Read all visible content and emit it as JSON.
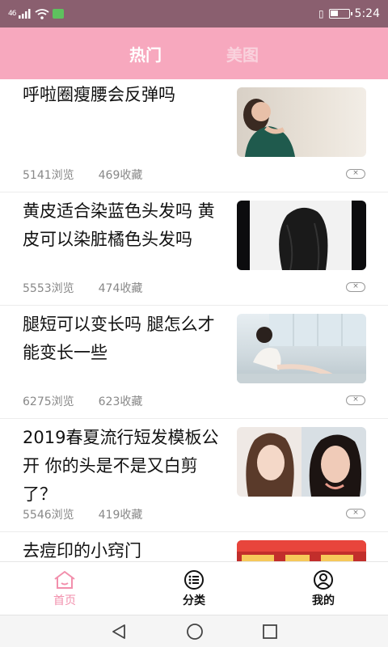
{
  "status_bar": {
    "signal_text": "46",
    "time": "5:24"
  },
  "header": {
    "tabs": [
      {
        "label": "热门",
        "active": true
      },
      {
        "label": "美图",
        "active": false
      }
    ]
  },
  "feed": {
    "items": [
      {
        "title": "呼啦圈瘦腰会反弹吗",
        "views": "5141浏览",
        "favorites": "469收藏"
      },
      {
        "title": "黄皮适合染蓝色头发吗 黄皮可以染脏橘色头发吗",
        "views": "5553浏览",
        "favorites": "474收藏"
      },
      {
        "title": "腿短可以变长吗 腿怎么才能变长一些",
        "views": "6275浏览",
        "favorites": "623收藏"
      },
      {
        "title": "2019春夏流行短发模板公开 你的头是不是又白剪了？",
        "views": "5546浏览",
        "favorites": "419收藏"
      },
      {
        "title": "去痘印的小窍门",
        "views": "",
        "favorites": ""
      }
    ]
  },
  "bottom_nav": {
    "items": [
      {
        "label": "首页",
        "icon": "home-icon",
        "active": true
      },
      {
        "label": "分类",
        "icon": "category-icon",
        "active": false
      },
      {
        "label": "我的",
        "icon": "profile-icon",
        "active": false
      }
    ]
  },
  "colors": {
    "header_bg": "#f7a8be",
    "active_nav": "#f28fac",
    "status_bar_bg": "#8a5f6f"
  }
}
